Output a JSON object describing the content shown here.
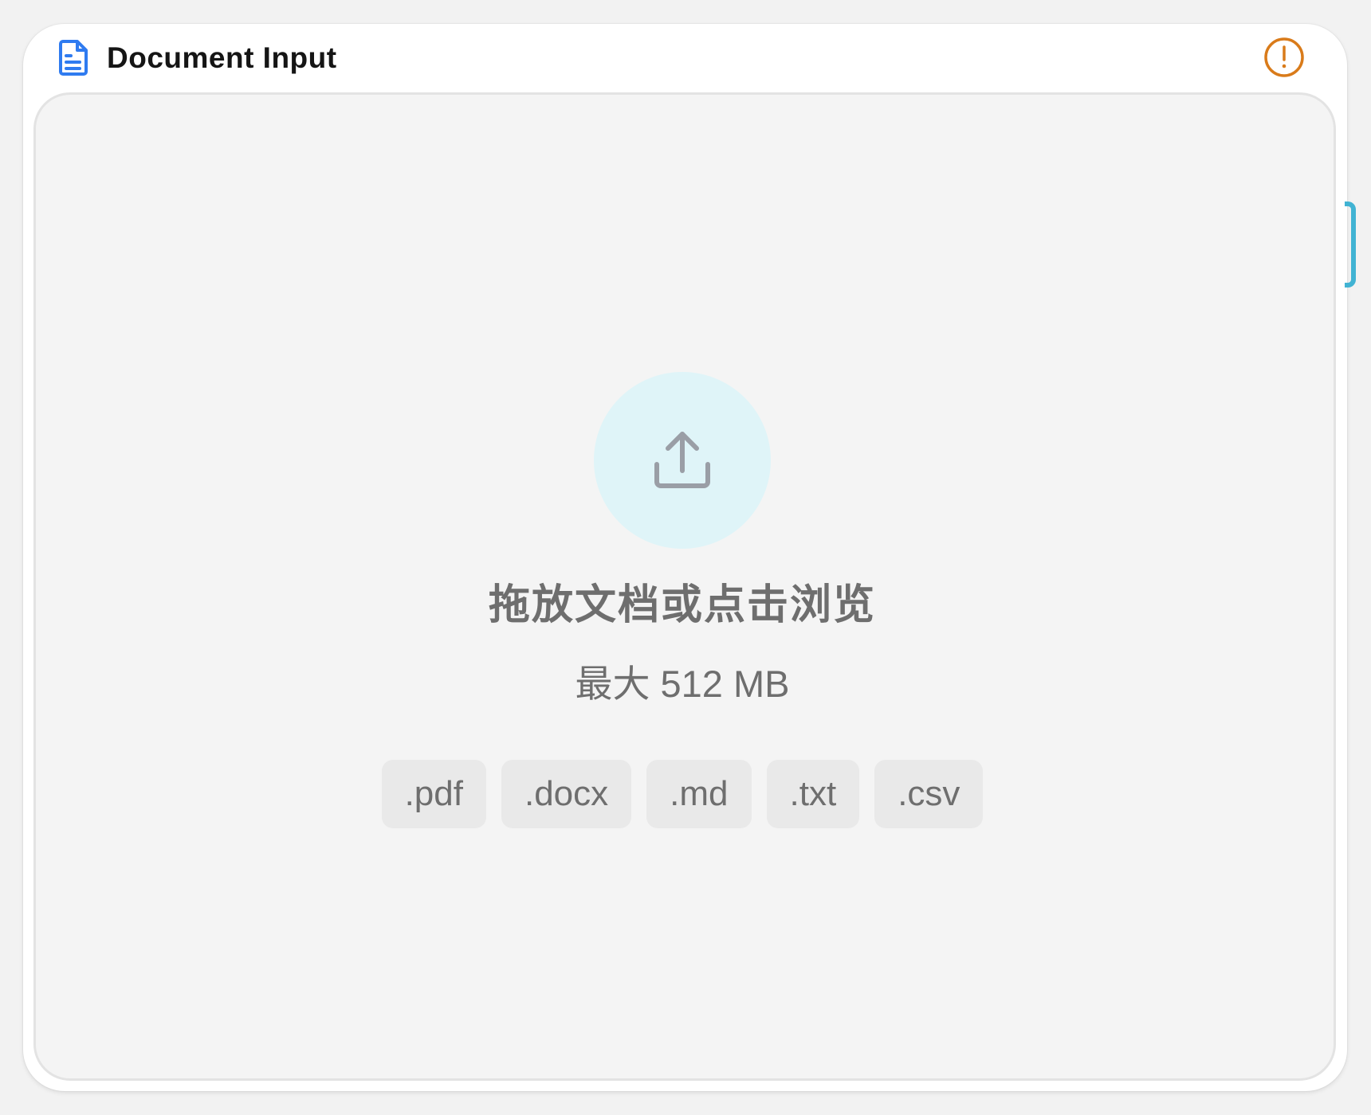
{
  "node": {
    "title": "Document Input",
    "icon": "document-icon",
    "status_icon": "warning-icon",
    "colors": {
      "icon_blue": "#2f7bf0",
      "warning_orange": "#d97b1a",
      "handle_cyan": "#41b3d3",
      "upload_circle_bg": "#dff4f8"
    }
  },
  "dropzone": {
    "icon": "upload-icon",
    "title": "拖放文档或点击浏览",
    "limit": "最大 512 MB",
    "formats": [
      ".pdf",
      ".docx",
      ".md",
      ".txt",
      ".csv"
    ]
  }
}
